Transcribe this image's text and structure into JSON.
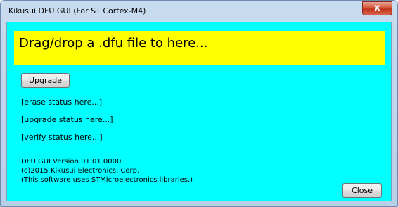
{
  "window": {
    "title": "Kikusui DFU GUI (For ST Cortex-M4)",
    "close_glyph": "x"
  },
  "drop_zone": {
    "text": "Drag/drop a .dfu file to here..."
  },
  "buttons": {
    "upgrade": "Upgrade",
    "close": "Close"
  },
  "status": {
    "erase": "[erase status here...]",
    "upgrade": "[upgrade status here...]",
    "verify": "[verify status here...]"
  },
  "info": {
    "version": "DFU GUI Version 01.01.0000",
    "copyright": "(c)2015 Kikusui Electronics, Corp.",
    "notice": "(This software uses STMicroelectronics libraries.)"
  },
  "colors": {
    "background": "#00ffff",
    "drop_zone": "#ffff00",
    "close_button": "#c1351c"
  },
  "icons": {
    "window_close": "close-icon"
  }
}
